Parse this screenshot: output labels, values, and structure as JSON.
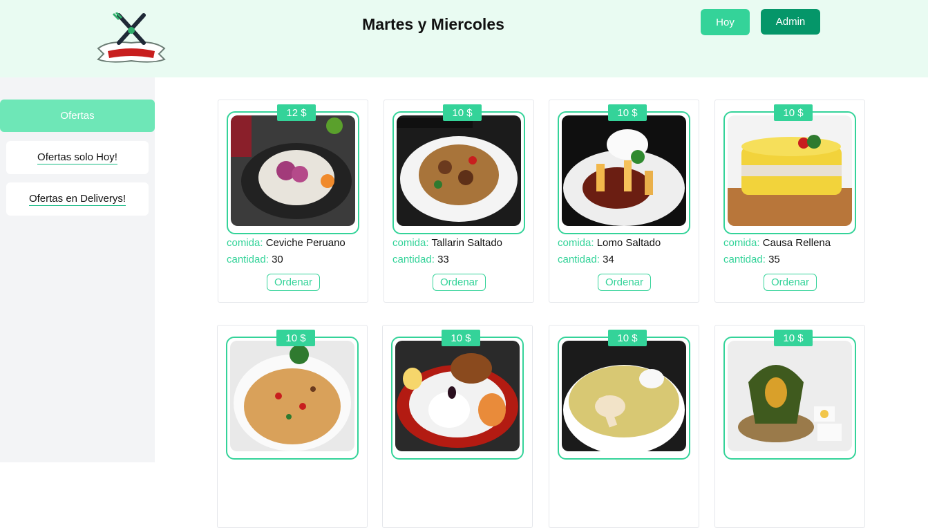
{
  "header": {
    "title": "Martes y Miercoles",
    "hoy_label": "Hoy",
    "admin_label": "Admin"
  },
  "sidebar": {
    "heading": "Ofertas",
    "items": [
      {
        "label": "Ofertas solo Hoy!"
      },
      {
        "label": "Ofertas en Deliverys!"
      }
    ]
  },
  "labels": {
    "comida": "comida:",
    "cantidad": "cantidad:",
    "order": "Ordenar"
  },
  "cards": [
    {
      "price": "12 $",
      "name": "Ceviche Peruano",
      "qty": "30"
    },
    {
      "price": "10 $",
      "name": "Tallarin Saltado",
      "qty": "33"
    },
    {
      "price": "10 $",
      "name": "Lomo Saltado",
      "qty": "34"
    },
    {
      "price": "10 $",
      "name": "Causa Rellena",
      "qty": "35"
    },
    {
      "price": "10 $",
      "name": "",
      "qty": ""
    },
    {
      "price": "10 $",
      "name": "",
      "qty": ""
    },
    {
      "price": "10 $",
      "name": "",
      "qty": ""
    },
    {
      "price": "10 $",
      "name": "",
      "qty": ""
    }
  ],
  "colors": {
    "accent": "#34d399",
    "accent_dark": "#059669",
    "header_bg": "#e9fbf2",
    "sidebar_bg": "#f3f4f6",
    "sidebar_head": "#6ee7b7"
  }
}
